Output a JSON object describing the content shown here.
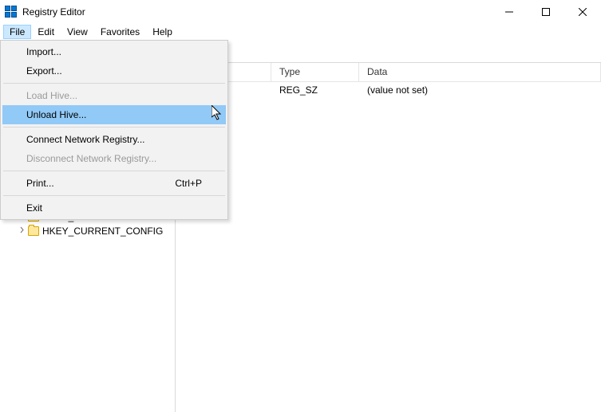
{
  "titlebar": {
    "title": "Registry Editor"
  },
  "menubar": {
    "items": [
      "File",
      "Edit",
      "View",
      "Favorites",
      "Help"
    ],
    "open_index": 0
  },
  "file_menu": {
    "import": "Import...",
    "export": "Export...",
    "load_hive": "Load Hive...",
    "unload_hive": "Unload Hive...",
    "connect": "Connect Network Registry...",
    "disconnect": "Disconnect Network Registry...",
    "print": "Print...",
    "print_shortcut": "Ctrl+P",
    "exit": "Exit"
  },
  "tree": {
    "visible_items": [
      {
        "label": "HKEY_USERS"
      },
      {
        "label": "HKEY_CURRENT_CONFIG"
      }
    ]
  },
  "list": {
    "columns": {
      "name": "",
      "type": "Type",
      "data": "Data"
    },
    "rows": [
      {
        "name": "",
        "type": "REG_SZ",
        "data": "(value not set)"
      }
    ]
  }
}
